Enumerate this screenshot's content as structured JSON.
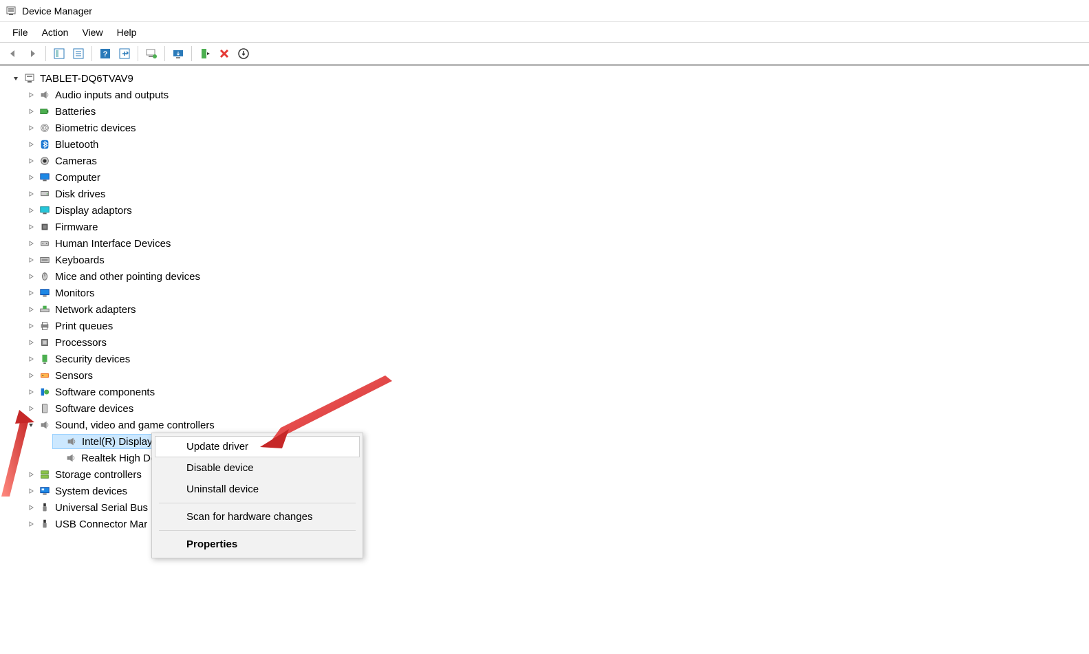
{
  "window": {
    "title": "Device Manager"
  },
  "menu": {
    "file": "File",
    "action": "Action",
    "view": "View",
    "help": "Help"
  },
  "tree": {
    "root": "TABLET-DQ6TVAV9",
    "categories": [
      {
        "label": "Audio inputs and outputs",
        "icon": "speaker"
      },
      {
        "label": "Batteries",
        "icon": "battery"
      },
      {
        "label": "Biometric devices",
        "icon": "fingerprint"
      },
      {
        "label": "Bluetooth",
        "icon": "bluetooth"
      },
      {
        "label": "Cameras",
        "icon": "camera"
      },
      {
        "label": "Computer",
        "icon": "monitor"
      },
      {
        "label": "Disk drives",
        "icon": "disk"
      },
      {
        "label": "Display adaptors",
        "icon": "display"
      },
      {
        "label": "Firmware",
        "icon": "chip"
      },
      {
        "label": "Human Interface Devices",
        "icon": "hid"
      },
      {
        "label": "Keyboards",
        "icon": "keyboard"
      },
      {
        "label": "Mice and other pointing devices",
        "icon": "mouse"
      },
      {
        "label": "Monitors",
        "icon": "monitor"
      },
      {
        "label": "Network adapters",
        "icon": "network"
      },
      {
        "label": "Print queues",
        "icon": "printer"
      },
      {
        "label": "Processors",
        "icon": "cpu"
      },
      {
        "label": "Security devices",
        "icon": "security"
      },
      {
        "label": "Sensors",
        "icon": "sensor"
      },
      {
        "label": "Software components",
        "icon": "component"
      },
      {
        "label": "Software devices",
        "icon": "softdev"
      },
      {
        "label": "Sound, video and game controllers",
        "icon": "speaker",
        "expanded": true,
        "children": [
          {
            "label": "Intel(R) Display Audio",
            "icon": "speaker",
            "selected": true,
            "truncated": "Intel(R) Display A"
          },
          {
            "label": "Realtek High Definition Audio",
            "icon": "speaker",
            "truncated": "Realtek High De"
          }
        ]
      },
      {
        "label": "Storage controllers",
        "icon": "storage"
      },
      {
        "label": "System devices",
        "icon": "system"
      },
      {
        "label": "Universal Serial Bus",
        "icon": "usb",
        "truncated": "Universal Serial Bus"
      },
      {
        "label": "USB Connector Manager",
        "icon": "usb",
        "truncated": "USB Connector Mar"
      }
    ]
  },
  "contextMenu": {
    "updateDriver": "Update driver",
    "disableDevice": "Disable device",
    "uninstallDevice": "Uninstall device",
    "scan": "Scan for hardware changes",
    "properties": "Properties"
  }
}
